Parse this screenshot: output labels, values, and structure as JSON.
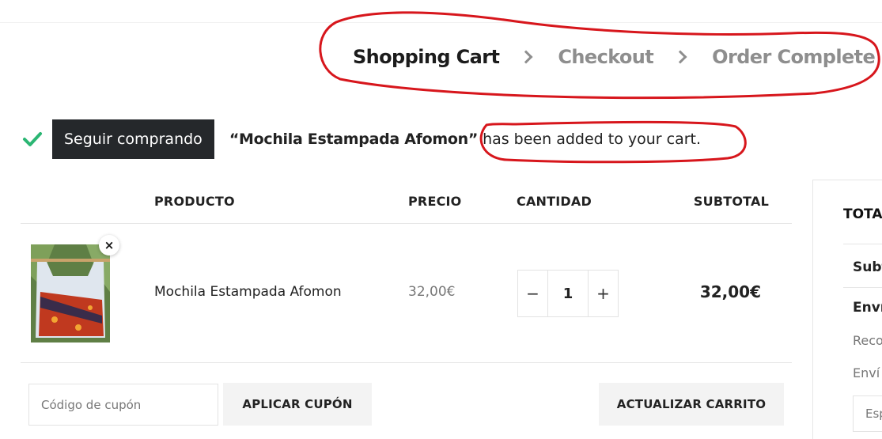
{
  "steps": {
    "cart": "Shopping Cart",
    "checkout": "Checkout",
    "complete": "Order Complete"
  },
  "notice": {
    "button": "Seguir comprando",
    "product": "“Mochila Estampada Afomon”",
    "message": "has been added to your cart."
  },
  "table": {
    "headers": {
      "product": "PRODUCTO",
      "price": "PRECIO",
      "quantity": "CANTIDAD",
      "subtotal": "SUBTOTAL"
    },
    "row": {
      "remove": "×",
      "name": "Mochila Estampada Afomon",
      "price": "32,00€",
      "quantity": "1",
      "minus": "−",
      "plus": "+",
      "subtotal": "32,00€"
    }
  },
  "actions": {
    "coupon_placeholder": "Código de cupón",
    "apply_coupon": "APLICAR CUPÓN",
    "update_cart": "ACTUALIZAR CARRITO"
  },
  "totals": {
    "title": "TOTA",
    "subtotal": "Subt",
    "shipping": "Enví",
    "pickup": "Reco",
    "shipping2": "Enví",
    "select": "Esp"
  },
  "colors": {
    "annotation_red": "#d7161c",
    "check_green": "#2bb673",
    "dark_button": "#25282b"
  }
}
